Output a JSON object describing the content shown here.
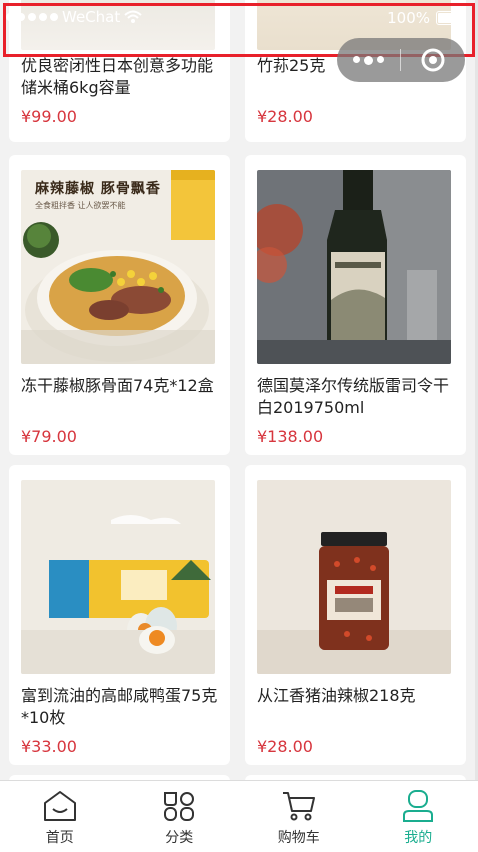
{
  "status_bar": {
    "carrier": "WeChat",
    "battery": "100%"
  },
  "products": [
    {
      "title": "优良密闭性日本创意多功能储米桶6kg容量",
      "price": "¥99.00"
    },
    {
      "title": "竹荪25克",
      "price": "¥28.00"
    },
    {
      "title": "冻干藤椒豚骨面74克*12盒",
      "price": "¥79.00"
    },
    {
      "title": "德国莫泽尔传统版雷司令干白2019750ml",
      "price": "¥138.00"
    },
    {
      "title": "富到流油的高邮咸鸭蛋75克*10枚",
      "price": "¥33.00"
    },
    {
      "title": "从江香猪油辣椒218克",
      "price": "¥28.00"
    }
  ],
  "noodle_banner": {
    "headline": "麻辣藤椒 豚骨飘香",
    "sub": "全食粗拌香 让人欲罢不能"
  },
  "tabs": [
    {
      "label": "首页",
      "icon": "home-icon"
    },
    {
      "label": "分类",
      "icon": "category-icon"
    },
    {
      "label": "购物车",
      "icon": "cart-icon"
    },
    {
      "label": "我的",
      "icon": "profile-icon"
    }
  ],
  "colors": {
    "price": "#d7363e",
    "active_tab": "#1aad8f",
    "highlight_box": "#e8202a"
  }
}
